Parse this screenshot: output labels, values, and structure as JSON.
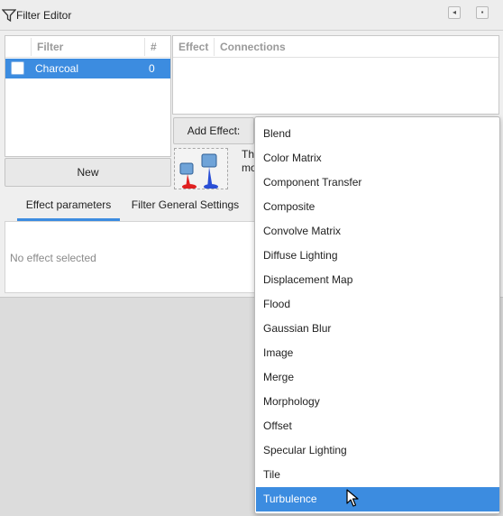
{
  "window": {
    "title": "Filter Editor",
    "title_icon": "filter-funnel-icon",
    "controls": [
      "dock-icon",
      "close-icon"
    ]
  },
  "filters": {
    "columns": [
      "Filter",
      "#"
    ],
    "rows": [
      {
        "name": "Charcoal",
        "count": "0",
        "selected": true,
        "checked": false
      }
    ]
  },
  "new_button": "New",
  "effects": {
    "columns": [
      "Effect",
      "Connections"
    ]
  },
  "add_effect": {
    "label": "Add Effect:"
  },
  "effect_info": {
    "icon": "paint-buckets-icon",
    "line1": "The",
    "line2": "mo"
  },
  "tabs": [
    {
      "label": "Effect parameters",
      "active": true
    },
    {
      "label": "Filter General Settings",
      "active": false
    }
  ],
  "tab_content": {
    "empty_text": "No effect selected"
  },
  "dropdown": {
    "items": [
      "Blend",
      "Color Matrix",
      "Component Transfer",
      "Composite",
      "Convolve Matrix",
      "Diffuse Lighting",
      "Displacement Map",
      "Flood",
      "Gaussian Blur",
      "Image",
      "Merge",
      "Morphology",
      "Offset",
      "Specular Lighting",
      "Tile",
      "Turbulence"
    ],
    "highlighted": "Turbulence"
  },
  "colors": {
    "accent": "#3c8ce0",
    "background": "#dcdcdc"
  }
}
